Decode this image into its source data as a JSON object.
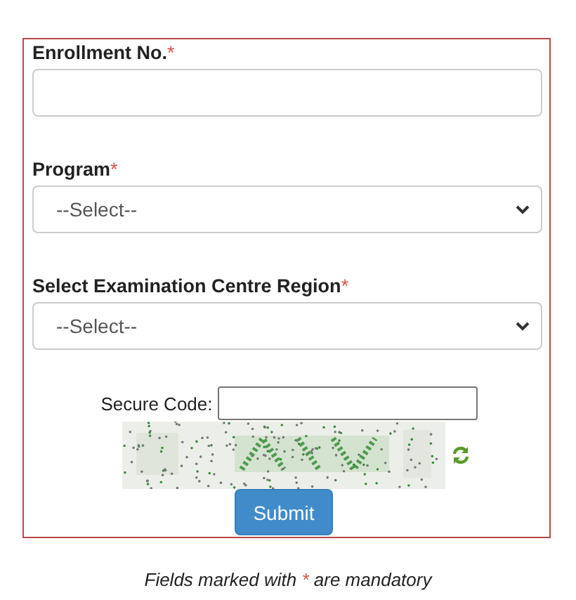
{
  "fields": [
    {
      "kind": "text",
      "label": "Enrollment No.",
      "required_mark": "*"
    },
    {
      "kind": "select",
      "label": "Program",
      "required_mark": "*",
      "value": "--Select--"
    },
    {
      "kind": "select",
      "label": "Select Examination Centre Region",
      "required_mark": "*",
      "value": "--Select--"
    }
  ],
  "secure_code": {
    "label": "Secure Code:"
  },
  "submit": "Submit",
  "footnote": {
    "before": "Fields marked with ",
    "mark": "*",
    "after": " are mandatory"
  }
}
